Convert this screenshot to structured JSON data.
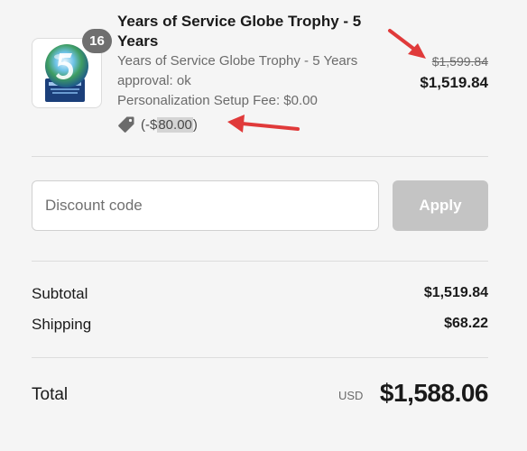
{
  "product": {
    "quantity": "16",
    "title_line1": "Years of Service Globe Trophy - 5",
    "title_line2": "Years",
    "variant": "Years of Service Globe Trophy - 5 Years",
    "approval": "approval: ok",
    "setup_fee": "Personalization Setup Fee: $0.00",
    "discount_prefix": "(-$",
    "discount_amount": "80.00",
    "discount_suffix": ")",
    "original_price": "$1,599.84",
    "price": "$1,519.84",
    "image_icon": "globe-trophy-image"
  },
  "discount": {
    "placeholder": "Discount code",
    "apply_label": "Apply"
  },
  "summary": {
    "subtotal_label": "Subtotal",
    "subtotal_value": "$1,519.84",
    "shipping_label": "Shipping",
    "shipping_value": "$68.22",
    "total_label": "Total",
    "currency": "USD",
    "total_value": "$1,588.06"
  },
  "colors": {
    "background": "#f5f5f5",
    "annotation_arrow": "#e03a3a",
    "apply_button_disabled": "#c4c4c4",
    "quantity_badge": "#6f6f6f"
  }
}
